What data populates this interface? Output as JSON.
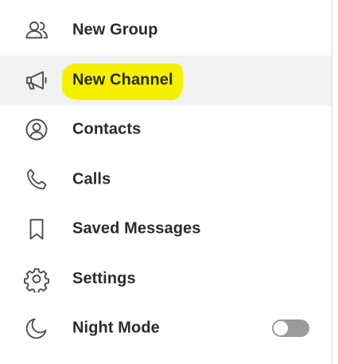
{
  "menu": {
    "items": [
      {
        "label": "New Group",
        "icon": "users-icon"
      },
      {
        "label": "New Channel",
        "icon": "megaphone-icon",
        "highlighted": true
      },
      {
        "label": "Contacts",
        "icon": "user-circle-icon"
      },
      {
        "label": "Calls",
        "icon": "phone-icon"
      },
      {
        "label": "Saved Messages",
        "icon": "bookmark-icon"
      },
      {
        "label": "Settings",
        "icon": "gear-icon"
      },
      {
        "label": "Night Mode",
        "icon": "moon-icon"
      }
    ],
    "night_mode": {
      "enabled": false
    }
  },
  "colors": {
    "highlight": "#f5f000",
    "active_row": "#f1f1f1",
    "text": "#2b2b2b",
    "icon": "#4e4e4e",
    "toggle_off": "#9b9b9b"
  }
}
